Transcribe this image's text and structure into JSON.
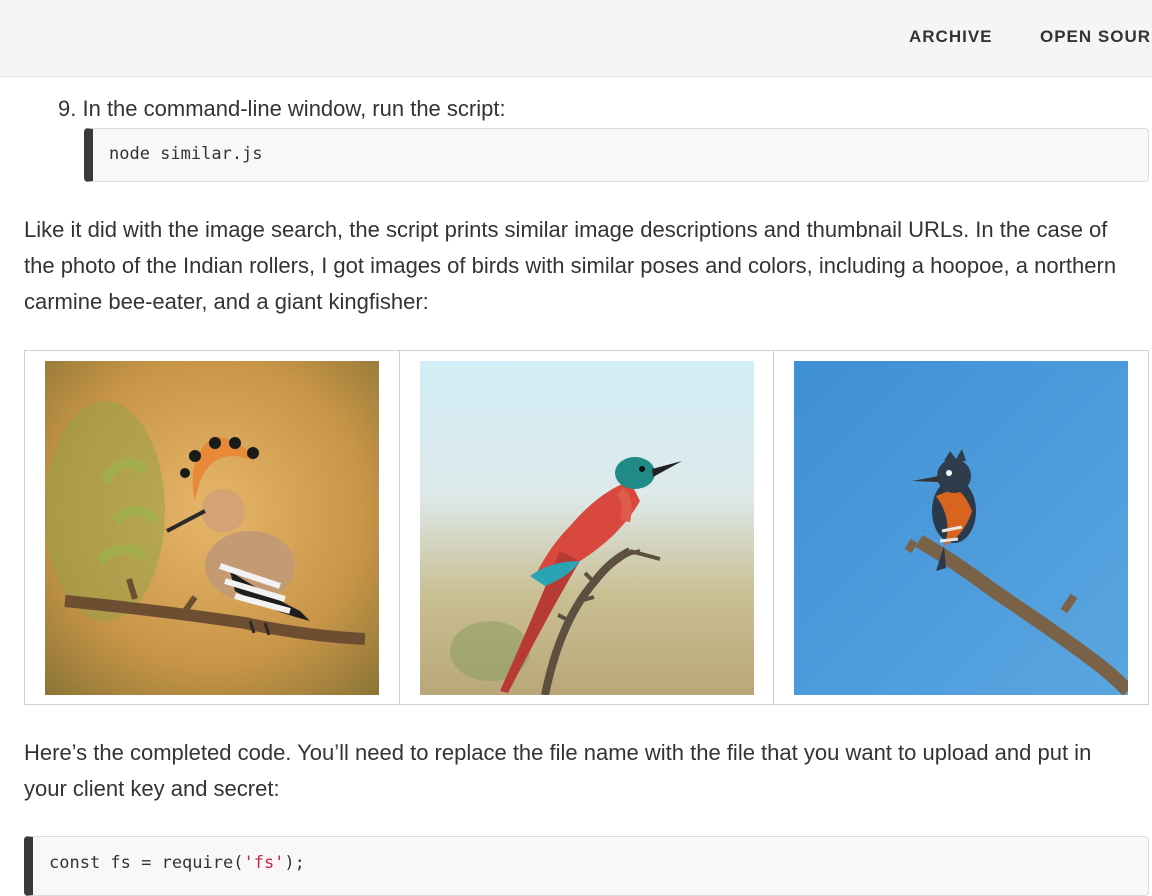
{
  "nav": {
    "items": [
      "ARCHIVE",
      "OPEN SOUR"
    ]
  },
  "step": {
    "number": "9.",
    "text": "In the command-line window, run the script:"
  },
  "code1": {
    "text": "node similar.js"
  },
  "paragraph1": "Like it did with the image search, the script prints similar image descriptions and thumbnail URLs. In the case of the photo of the Indian rollers, I got images of birds with similar poses and colors, including a hoopoe, a northern carmine bee-eater, and a giant kingfisher:",
  "images": [
    {
      "subject": "hoopoe"
    },
    {
      "subject": "northern carmine bee-eater"
    },
    {
      "subject": "giant kingfisher"
    }
  ],
  "paragraph2": "Here’s the completed code. You’ll need to replace the file name with the file that you want to upload and put in your client key and secret:",
  "code2": {
    "prefix": "const fs = require(",
    "string": "'fs'",
    "suffix": ");"
  },
  "colors": {
    "nav_bg": "#f5f5f5",
    "code_bg": "#f8f8f8",
    "code_border_left": "#3a3a3a",
    "string_token": "#c7254e"
  }
}
